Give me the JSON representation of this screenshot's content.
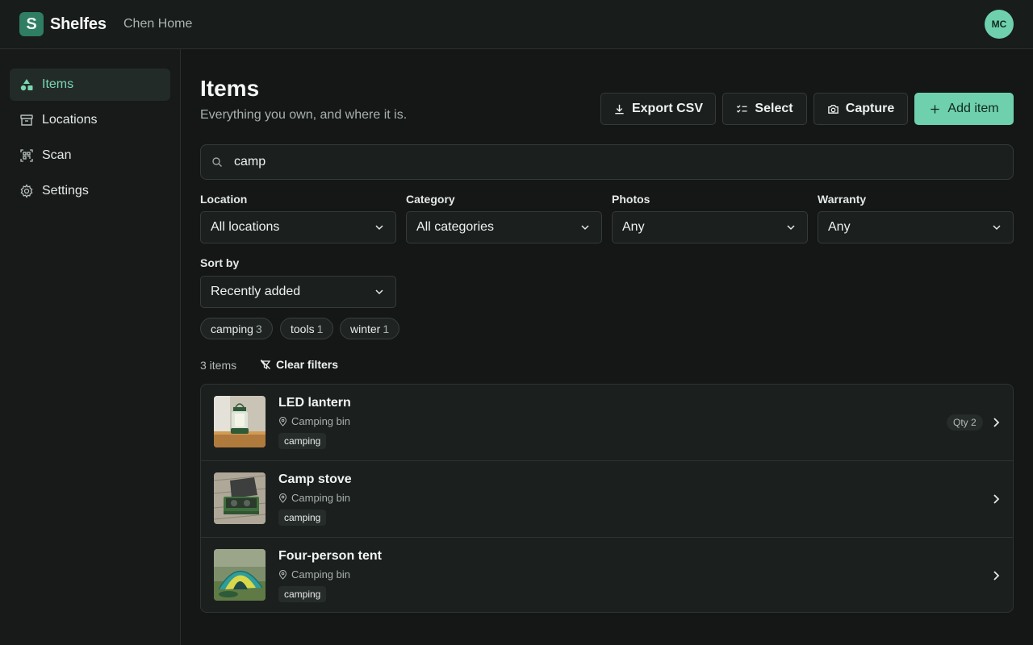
{
  "header": {
    "logo_letter": "S",
    "brand": "Shelfes",
    "household": "Chen Home",
    "avatar_initials": "MC"
  },
  "sidebar": {
    "items": [
      {
        "label": "Items",
        "icon": "shapes-icon",
        "active": true
      },
      {
        "label": "Locations",
        "icon": "archive-box-icon",
        "active": false
      },
      {
        "label": "Scan",
        "icon": "qr-scan-icon",
        "active": false
      },
      {
        "label": "Settings",
        "icon": "gear-icon",
        "active": false
      }
    ]
  },
  "main": {
    "title": "Items",
    "subtitle": "Everything you own, and where it is.",
    "actions": {
      "export": "Export CSV",
      "select": "Select",
      "capture": "Capture",
      "add": "Add item"
    },
    "search": {
      "value": "camp"
    },
    "filters": {
      "location": {
        "label": "Location",
        "value": "All locations"
      },
      "category": {
        "label": "Category",
        "value": "All categories"
      },
      "photos": {
        "label": "Photos",
        "value": "Any"
      },
      "warranty": {
        "label": "Warranty",
        "value": "Any"
      },
      "sort": {
        "label": "Sort by",
        "value": "Recently added"
      }
    },
    "tag_chips": [
      {
        "name": "camping",
        "count": "3"
      },
      {
        "name": "tools",
        "count": "1"
      },
      {
        "name": "winter",
        "count": "1"
      }
    ],
    "result_count": "3 items",
    "clear_filters": "Clear filters",
    "items": [
      {
        "name": "LED lantern",
        "location": "Camping bin",
        "tag": "camping",
        "qty": "Qty 2",
        "thumb": "lantern-photo"
      },
      {
        "name": "Camp stove",
        "location": "Camping bin",
        "tag": "camping",
        "thumb": "stove-photo"
      },
      {
        "name": "Four-person tent",
        "location": "Camping bin",
        "tag": "camping",
        "thumb": "tent-photo"
      }
    ]
  },
  "colors": {
    "accent": "#6fd0ad",
    "brand_mark": "#2f7d62",
    "background": "#141716"
  }
}
